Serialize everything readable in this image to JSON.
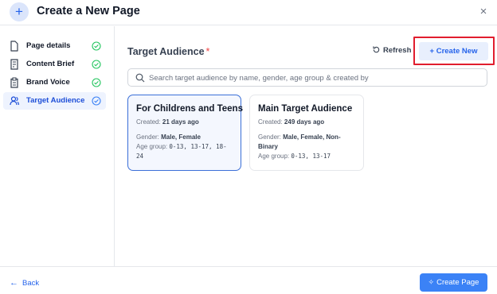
{
  "header": {
    "title": "Create a New Page",
    "icon": "plus-icon",
    "close_symbol": "×"
  },
  "steps": [
    {
      "label": "Page details",
      "icon": "file-icon",
      "done": true
    },
    {
      "label": "Content Brief",
      "icon": "brief-icon",
      "done": true
    },
    {
      "label": "Brand Voice",
      "icon": "clipboard-icon",
      "done": true
    },
    {
      "label": "Target Audience",
      "icon": "users-icon",
      "done": true,
      "active": true
    }
  ],
  "main": {
    "title": "Target Audience",
    "required_mark": "*",
    "refresh_label": "Refresh",
    "create_new_label": "+ Create New",
    "search_placeholder": "Search target audience by name, gender, age group & created by"
  },
  "cards": [
    {
      "title": "For Childrens and Teens",
      "created_label": "Created:",
      "created": "21 days ago",
      "gender_label": "Gender:",
      "gender": "Male, Female",
      "age_label": "Age group:",
      "age": "0-13, 13-17, 18-24",
      "selected": true
    },
    {
      "title": "Main Target Audience",
      "created_label": "Created:",
      "created": "249 days ago",
      "gender_label": "Gender:",
      "gender": "Male, Female, Non-Binary",
      "age_label": "Age group:",
      "age": "0-13, 13-17",
      "selected": false
    }
  ],
  "footer": {
    "back_label": "Back",
    "create_page_label": "Create Page"
  },
  "colors": {
    "accent": "#2563eb",
    "check": "#22c55e",
    "highlight": "#e11d2e",
    "required": "#ef4444"
  }
}
